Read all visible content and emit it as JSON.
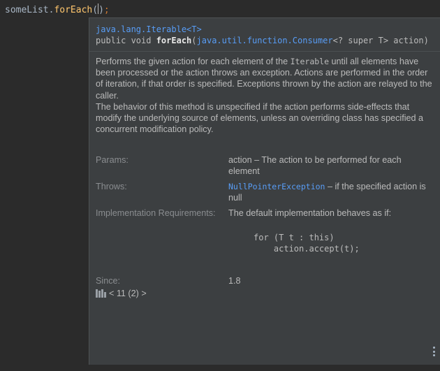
{
  "editor": {
    "receiver": "someList.",
    "method": "forEach",
    "open_paren": "(",
    "close_paren": ")",
    "semicolon": ";"
  },
  "popup": {
    "class_link": "java.lang.Iterable<T>",
    "sig_prefix": "public void ",
    "sig_method": "forEach",
    "sig_open": "(",
    "sig_param_type_link": "java.util.function.Consumer",
    "sig_rest": "<? super T> action)",
    "description": {
      "p1_before": "Performs the given action for each element of the ",
      "p1_code": "Iterable",
      "p1_after": " until all elements have been processed or the action throws an exception. Actions are performed in the order of iteration, if that order is specified. Exceptions thrown by the action are relayed to the caller.",
      "p2": "The behavior of this method is unspecified if the action performs side-effects that modify the underlying source of elements, unless an overriding class has specified a concurrent modification policy."
    },
    "params_label": "Params:",
    "params_value": "action – The action to be performed for each element",
    "throws_label": "Throws:",
    "throws_link": "NullPointerException",
    "throws_rest": " – if the specified action is null",
    "impl_label": "Implementation Requirements:",
    "impl_value": "The default implementation behaves as if:",
    "code_block": "for (T t : this)\n    action.accept(t);",
    "since_label": "Since:",
    "since_value": "1.8",
    "footer_sdk": "< 11 (2) >"
  },
  "icons": {
    "library": "library-icon",
    "more": "more-options-icon"
  },
  "colors": {
    "editor_bg": "#2b2b2b",
    "popup_bg": "#3c3f41",
    "link": "#589df6",
    "method": "#ffc66d",
    "label": "#8a8d90"
  }
}
